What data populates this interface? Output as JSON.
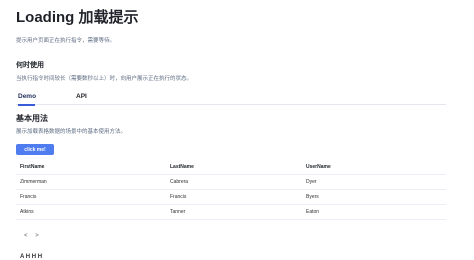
{
  "page": {
    "title": "Loading 加载提示",
    "description": "提示用户页面正在执行指令，需要等待。",
    "when_title": "何时使用",
    "when_description": "当执行指令时间较长（需要数秒以上）时，向用户展示正在执行的状态。"
  },
  "tabs": [
    {
      "label": "Demo",
      "active": true
    },
    {
      "label": "API",
      "active": false
    }
  ],
  "section": {
    "title": "基本用法",
    "description": "展示加载表格数据的场景中的基本使用方法。",
    "button_label": "click me!"
  },
  "table": {
    "columns": [
      "FirstName",
      "LastName",
      "UserName"
    ],
    "rows": [
      [
        "Zimmerman",
        "Cabrera",
        "Dyer"
      ],
      [
        "Francis",
        "Francis",
        "Byers"
      ],
      [
        "Atkins",
        "Tanner",
        "Eaton"
      ]
    ]
  },
  "code_toggle": "< >",
  "next_section_partial": "A H H H"
}
